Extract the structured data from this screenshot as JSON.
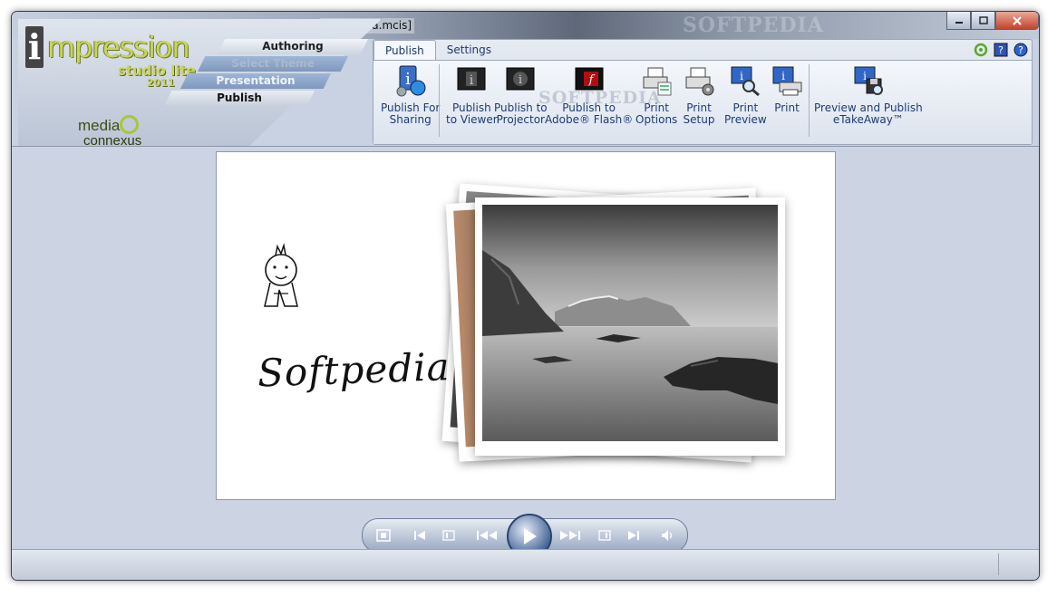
{
  "window": {
    "doc_title": "[Softpedia.mcis]",
    "titlebar_watermark": "SOFTPEDIA"
  },
  "logo": {
    "i_letter": "i",
    "impression": "mpression",
    "studio": "studio lite",
    "year": "2011",
    "media": "media",
    "connexus": "connexus"
  },
  "workflow_steps": {
    "authoring": "Authoring",
    "select_theme": "Select Theme",
    "presentation": "Presentation",
    "publish": "Publish"
  },
  "ribbon": {
    "tabs": [
      "Publish",
      "Settings"
    ],
    "watermark": "SOFTPEDIA",
    "buttons": [
      {
        "line1": "Publish For",
        "line2": "Sharing"
      },
      {
        "line1": "Publish",
        "line2": "to Viewer"
      },
      {
        "line1": "Publish to",
        "line2": "Projector"
      },
      {
        "line1": "Publish to",
        "line2": "Adobe® Flash®"
      },
      {
        "line1": "Print",
        "line2": "Options"
      },
      {
        "line1": "Print",
        "line2": "Setup"
      },
      {
        "line1": "Print",
        "line2": "Preview"
      },
      {
        "line1": "Print",
        "line2": ""
      },
      {
        "line1": "Preview and Publish",
        "line2": "eTakeAway™"
      }
    ]
  },
  "slide": {
    "signature_text": "Softpedia Test"
  },
  "colors": {
    "accent": "#1d3b78",
    "logo_green": "#c8d55a",
    "close_red": "#c2442c"
  }
}
